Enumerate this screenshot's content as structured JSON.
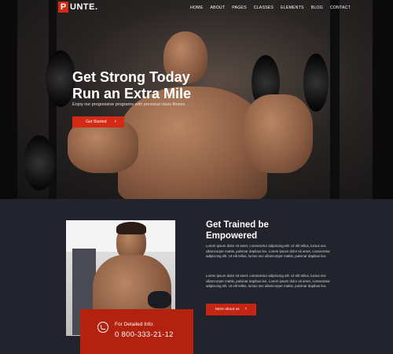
{
  "brand": {
    "logo_letter": "P",
    "logo_text": "UNTE.",
    "accent_color": "#d42a14",
    "background_color": "#22232d"
  },
  "nav": {
    "items": [
      "HOME",
      "ABOUT",
      "PAGES",
      "CLASSES",
      "ELEMENTS",
      "BLOG",
      "CONTACT"
    ]
  },
  "hero": {
    "title_line1": "Get Strong Today",
    "title_line2": "Run an Extra Mile",
    "subtitle": "Enjoy our progressive programs with personal class fitness",
    "button_label": "Get Started",
    "button_arrow": "›"
  },
  "about": {
    "title_line1": "Get Trained be",
    "title_line2": "Empowered",
    "paragraph1": "Lorem ipsum dolor sit amet, consectetur adipiscing elit. Ut elit tellus, luctus nec ullamcorper mattis, pulvinar dapibus leo. Lorem ipsum dolor sit amet, consectetur adipiscing elit. Ut elit tellus, luctus nec ullamcorper mattis, pulvinar dapibus leo.",
    "paragraph2": "Lorem ipsum dolor sit amet, consectetur adipiscing elit. Ut elit tellus, luctus nec ullamcorper mattis, pulvinar dapibus leo. Lorem ipsum dolor sit amet, consectetur adipiscing elit. Ut elit tellus, luctus nec ullamcorper mattis, pulvinar dapibus leo.",
    "button_label": "More about us",
    "button_arrow": "›"
  },
  "contact": {
    "icon": "whatsapp-icon",
    "label": "For Detailed Info:",
    "phone": "0 800-333-21-12"
  }
}
